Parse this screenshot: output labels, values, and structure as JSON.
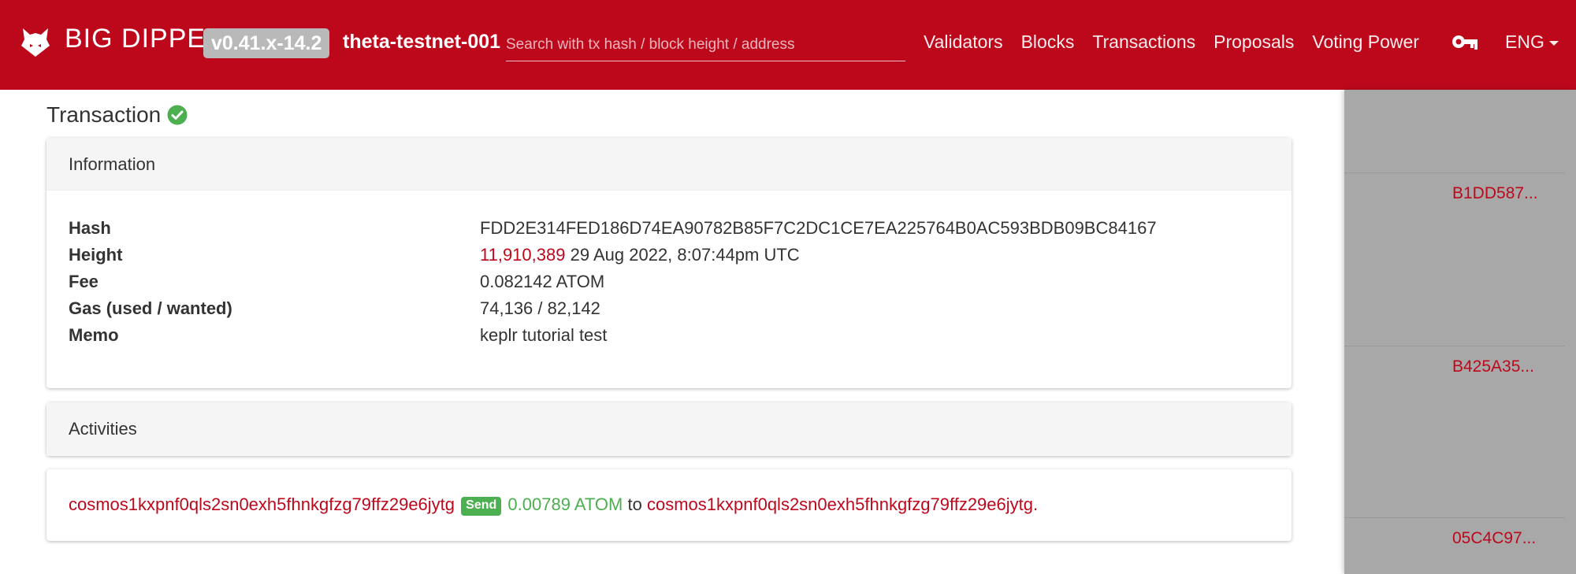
{
  "navbar": {
    "brand": "BIG DIPPER",
    "version": "v0.41.x-14.2",
    "chain_id": "theta-testnet-001",
    "search_placeholder": "Search with tx hash / block height / address",
    "links": [
      "Validators",
      "Blocks",
      "Transactions",
      "Proposals",
      "Voting Power"
    ],
    "language": "ENG",
    "brand_color": "#bd081c"
  },
  "page": {
    "title": "Transaction",
    "status_icon": "check-circle-icon"
  },
  "information": {
    "header": "Information",
    "rows": [
      {
        "label": "Hash",
        "value": "FDD2E314FED186D74EA90782B85F7C2DC1CE7EA225764B0AC593BDB09BC84167"
      },
      {
        "label": "Height",
        "link": "11,910,389",
        "value": "29 Aug 2022, 8:07:44pm UTC"
      },
      {
        "label": "Fee",
        "value": "0.082142 ATOM"
      },
      {
        "label": "Gas (used / wanted)",
        "value": "74,136 / 82,142"
      },
      {
        "label": "Memo",
        "value": "keplr tutorial test"
      }
    ]
  },
  "activities": {
    "header": "Activities",
    "from": "cosmos1kxpnf0qls2sn0exh5fhnkgfzg79ffz29e6jytg",
    "badge": "Send",
    "amount": "0.00789 ATOM",
    "to_word": "to",
    "to": "cosmos1kxpnf0qls2sn0exh5fhnkgfzg79ffz29e6jytg",
    "end": "."
  },
  "side_panel": {
    "hashes": [
      "B1DD587...",
      "B425A35...",
      "05C4C97..."
    ]
  }
}
